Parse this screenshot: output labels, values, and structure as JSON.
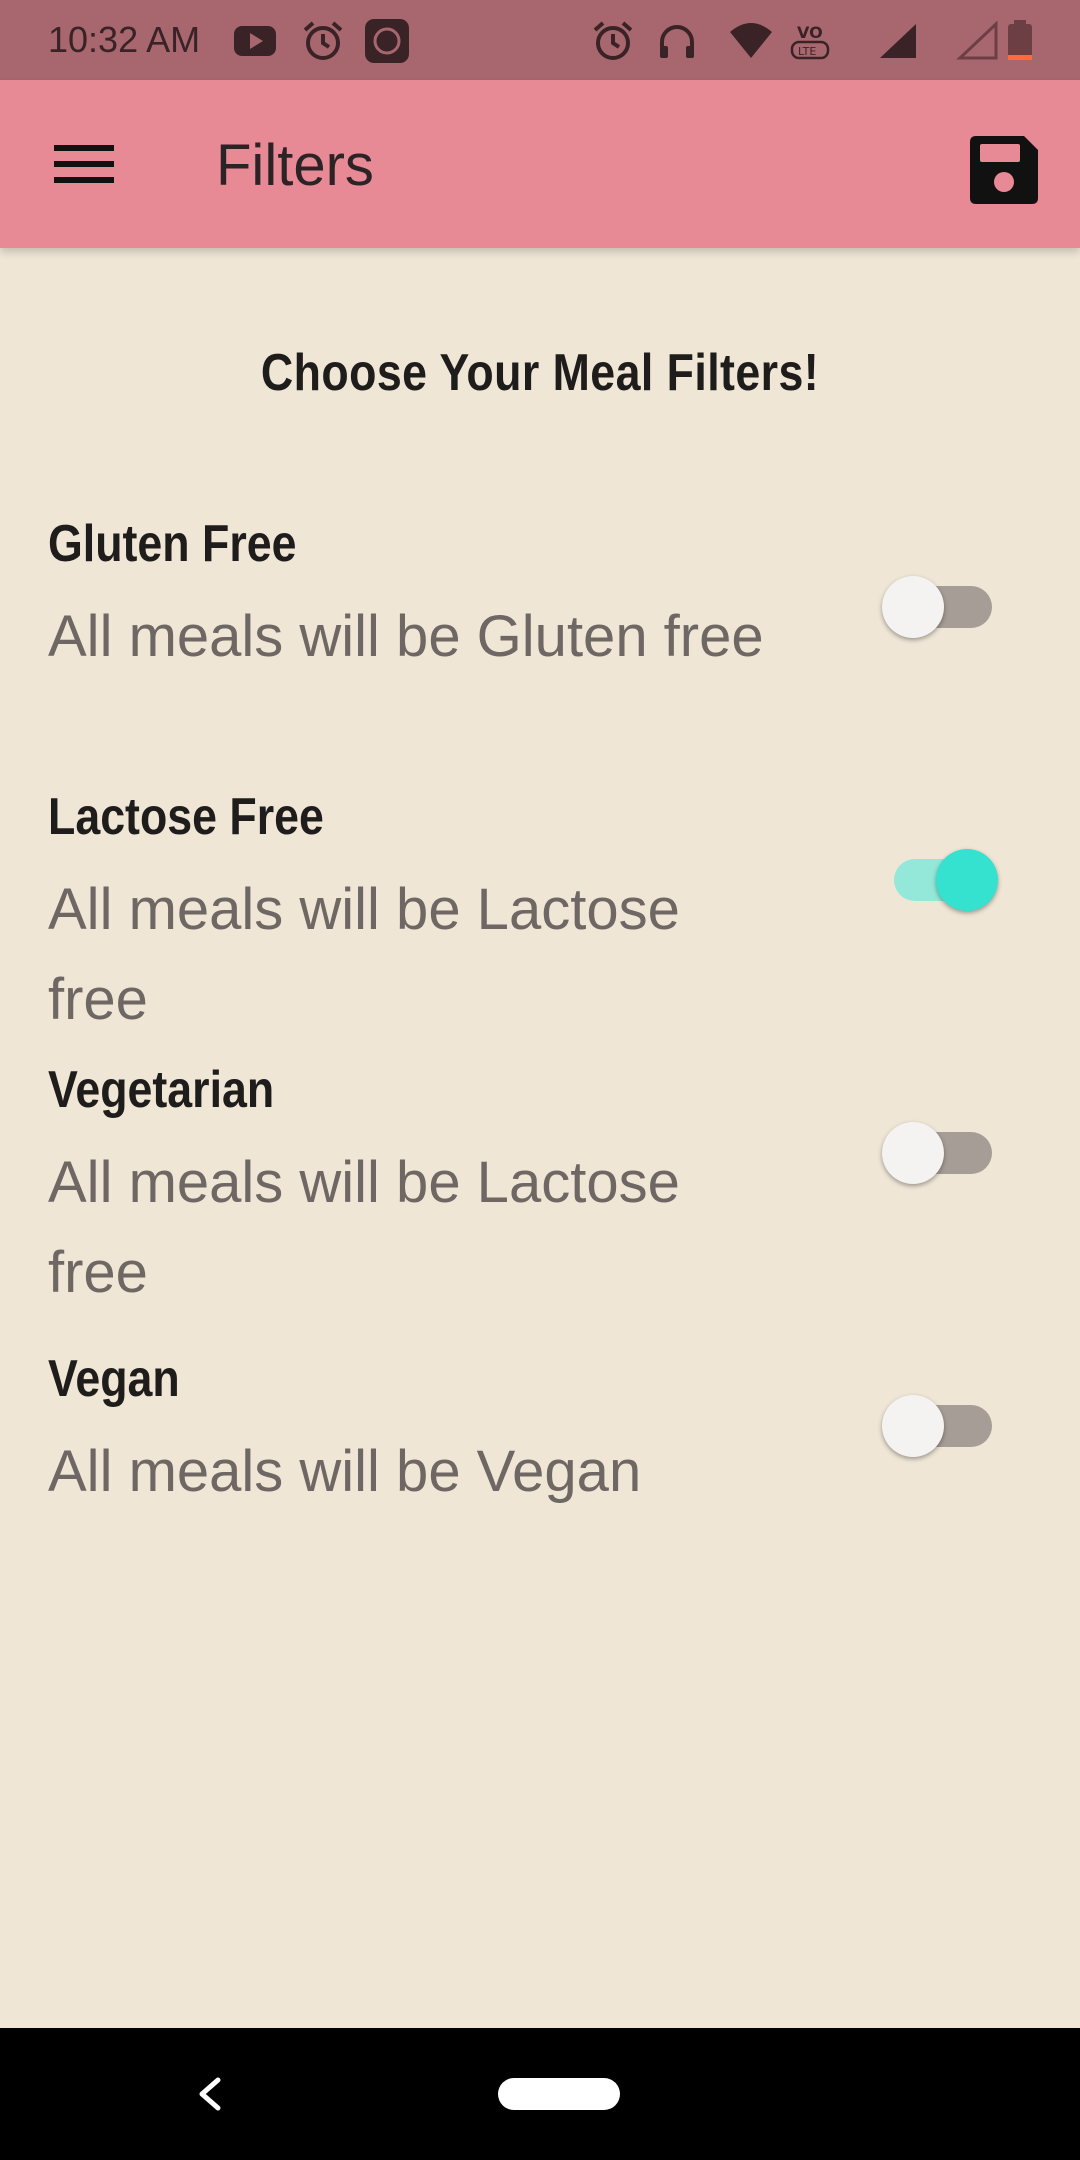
{
  "status_bar": {
    "time": "10:32 AM",
    "icons": [
      "youtube-icon",
      "alarm-icon",
      "mi-icon",
      "alarm-icon",
      "headphones-icon",
      "wifi-icon",
      "volte-icon",
      "signal-icon",
      "signal-empty-icon",
      "battery-low-icon"
    ]
  },
  "app_bar": {
    "title": "Filters",
    "menu_icon": "hamburger-menu-icon",
    "save_icon": "floppy-disk-icon",
    "background": "#e78a95"
  },
  "heading": "Choose Your Meal Filters!",
  "filters": [
    {
      "title": "Gluten Free",
      "subtitle": "All meals will be Gluten free",
      "enabled": false
    },
    {
      "title": "Lactose Free",
      "subtitle": "All meals will be Lactose free",
      "enabled": true
    },
    {
      "title": "Vegetarian",
      "subtitle": "All meals will be Lactose free",
      "enabled": false
    },
    {
      "title": "Vegan",
      "subtitle": "All meals will be Vegan",
      "enabled": false
    }
  ],
  "colors": {
    "background": "#efe6d6",
    "status_bar": "#a8676f",
    "switch_on": "#35e1cf",
    "switch_off_track": "#a59d96"
  },
  "nav_bar": {
    "back_icon": "back-chevron-icon",
    "home_icon": "home-pill-icon"
  }
}
